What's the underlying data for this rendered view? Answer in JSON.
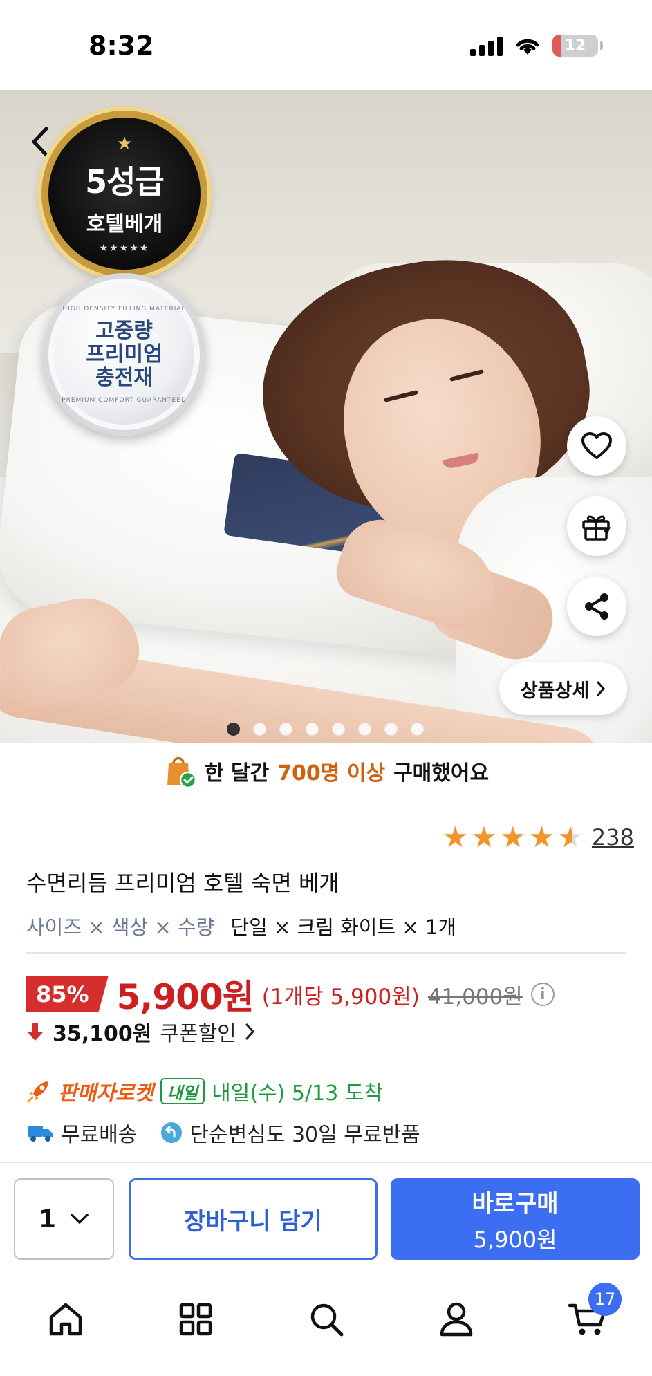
{
  "status_bar": {
    "time": "8:32",
    "battery": "12"
  },
  "hero": {
    "badge_gold": {
      "line1": "5성급",
      "line2": "호텔베개"
    },
    "badge_silver": {
      "ring_top": "HIGH DENSITY FILLING MATERIAL",
      "lines": [
        "고중량",
        "프리미엄",
        "충전재"
      ],
      "ring_bottom": "PREMIUM COMFORT GUARANTEED"
    },
    "detail_button": "상품상세",
    "carousel": {
      "total": 8,
      "active": 1
    }
  },
  "purchase_banner": {
    "prefix": "한 달간",
    "highlight": "700명 이상",
    "suffix": "구매했어요"
  },
  "rating": {
    "value": 4.5,
    "count": "238"
  },
  "product": {
    "title": "수면리듬 프리미엄 호텔 숙면 베개",
    "option_label": "사이즈 × 색상 × 수량",
    "option_value": "단일 × 크림 화이트 × 1개"
  },
  "price": {
    "discount": "85%",
    "sale": "5,900원",
    "per_unit": "(1개당 5,900원)",
    "original": "41,000원",
    "coupon_price": "35,100원",
    "coupon_label": "쿠폰할인"
  },
  "delivery": {
    "brand": "판매자로켓",
    "tag": "내일",
    "eta": "내일(수) 5/13 도착",
    "free_shipping": "무료배송",
    "free_return": "단순변심도 30일 무료반품"
  },
  "actions": {
    "quantity": "1",
    "cart_label": "장바구니 담기",
    "buy_label": "바로구매",
    "buy_price": "5,900원"
  },
  "tab_bar": {
    "cart_count": "17"
  },
  "colors": {
    "primary": "#3b6ef0",
    "sale_red": "#cc1f1f",
    "rocket_orange": "#ef5a13",
    "arrival_green": "#1e9a3e",
    "star": "#f2942a"
  }
}
